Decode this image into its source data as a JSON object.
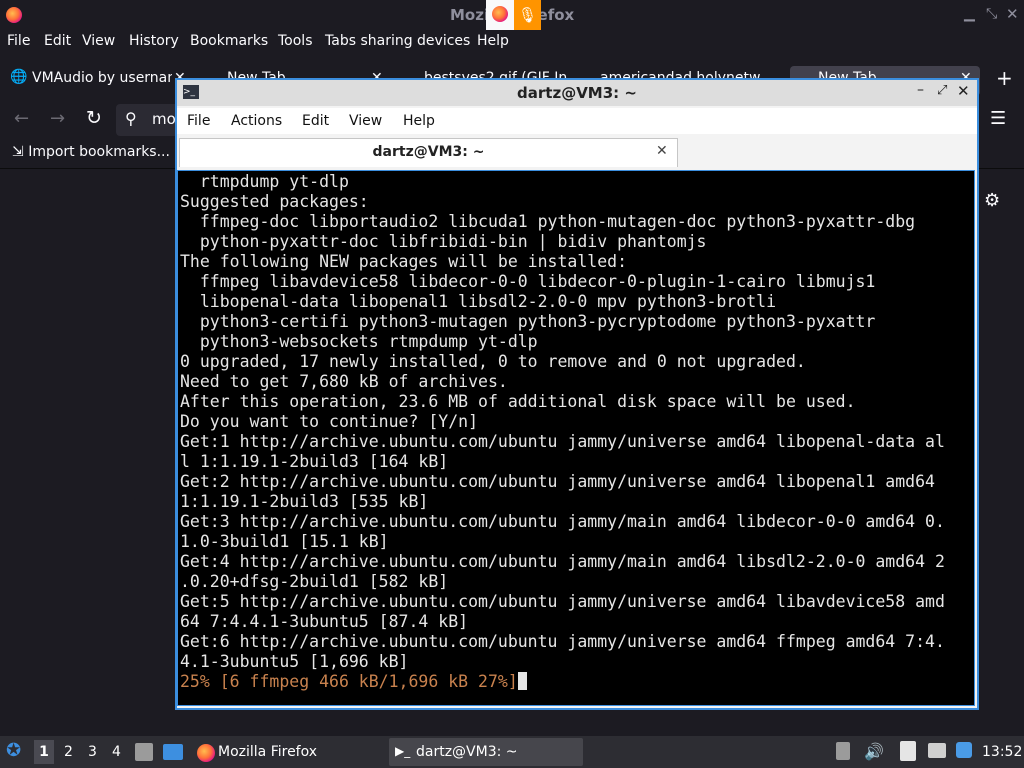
{
  "firefox": {
    "title": "Mozilla Firefox",
    "menu": [
      "File",
      "Edit",
      "View",
      "History",
      "Bookmarks",
      "Tools",
      "Tabs sharing devices",
      "Help"
    ],
    "tabs": [
      "VMAudio by usernan",
      "New Tab",
      "bestsves2 gif (GIF In",
      "americandad holynetw",
      "New Tab"
    ],
    "url_fragment": "mo",
    "bookmarks_item": "Import bookmarks..."
  },
  "terminal": {
    "title": "dartz@VM3: ~",
    "menu": [
      "File",
      "Actions",
      "Edit",
      "View",
      "Help"
    ],
    "tab_title": "dartz@VM3: ~",
    "lines": [
      "  rtmpdump yt-dlp",
      "Suggested packages:",
      "  ffmpeg-doc libportaudio2 libcuda1 python-mutagen-doc python3-pyxattr-dbg",
      "  python-pyxattr-doc libfribidi-bin | bidiv phantomjs",
      "The following NEW packages will be installed:",
      "  ffmpeg libavdevice58 libdecor-0-0 libdecor-0-plugin-1-cairo libmujs1",
      "  libopenal-data libopenal1 libsdl2-2.0-0 mpv python3-brotli",
      "  python3-certifi python3-mutagen python3-pycryptodome python3-pyxattr",
      "  python3-websockets rtmpdump yt-dlp",
      "0 upgraded, 17 newly installed, 0 to remove and 0 not upgraded.",
      "Need to get 7,680 kB of archives.",
      "After this operation, 23.6 MB of additional disk space will be used.",
      "Do you want to continue? [Y/n]",
      "Get:1 http://archive.ubuntu.com/ubuntu jammy/universe amd64 libopenal-data al",
      "l 1:1.19.1-2build3 [164 kB]",
      "Get:2 http://archive.ubuntu.com/ubuntu jammy/universe amd64 libopenal1 amd64",
      "1:1.19.1-2build3 [535 kB]",
      "Get:3 http://archive.ubuntu.com/ubuntu jammy/main amd64 libdecor-0-0 amd64 0.",
      "1.0-3build1 [15.1 kB]",
      "Get:4 http://archive.ubuntu.com/ubuntu jammy/main amd64 libsdl2-2.0-0 amd64 2",
      ".0.20+dfsg-2build1 [582 kB]",
      "Get:5 http://archive.ubuntu.com/ubuntu jammy/universe amd64 libavdevice58 amd",
      "64 7:4.4.1-3ubuntu5 [87.4 kB]",
      "Get:6 http://archive.ubuntu.com/ubuntu jammy/universe amd64 ffmpeg amd64 7:4.",
      "4.1-3ubuntu5 [1,696 kB]"
    ],
    "progress_line": "25% [6 ffmpeg 466 kB/1,696 kB 27%]"
  },
  "taskbar": {
    "workspaces": [
      "1",
      "2",
      "3",
      "4"
    ],
    "tasks": [
      "Mozilla Firefox",
      "dartz@VM3: ~"
    ],
    "clock": "13:52"
  }
}
